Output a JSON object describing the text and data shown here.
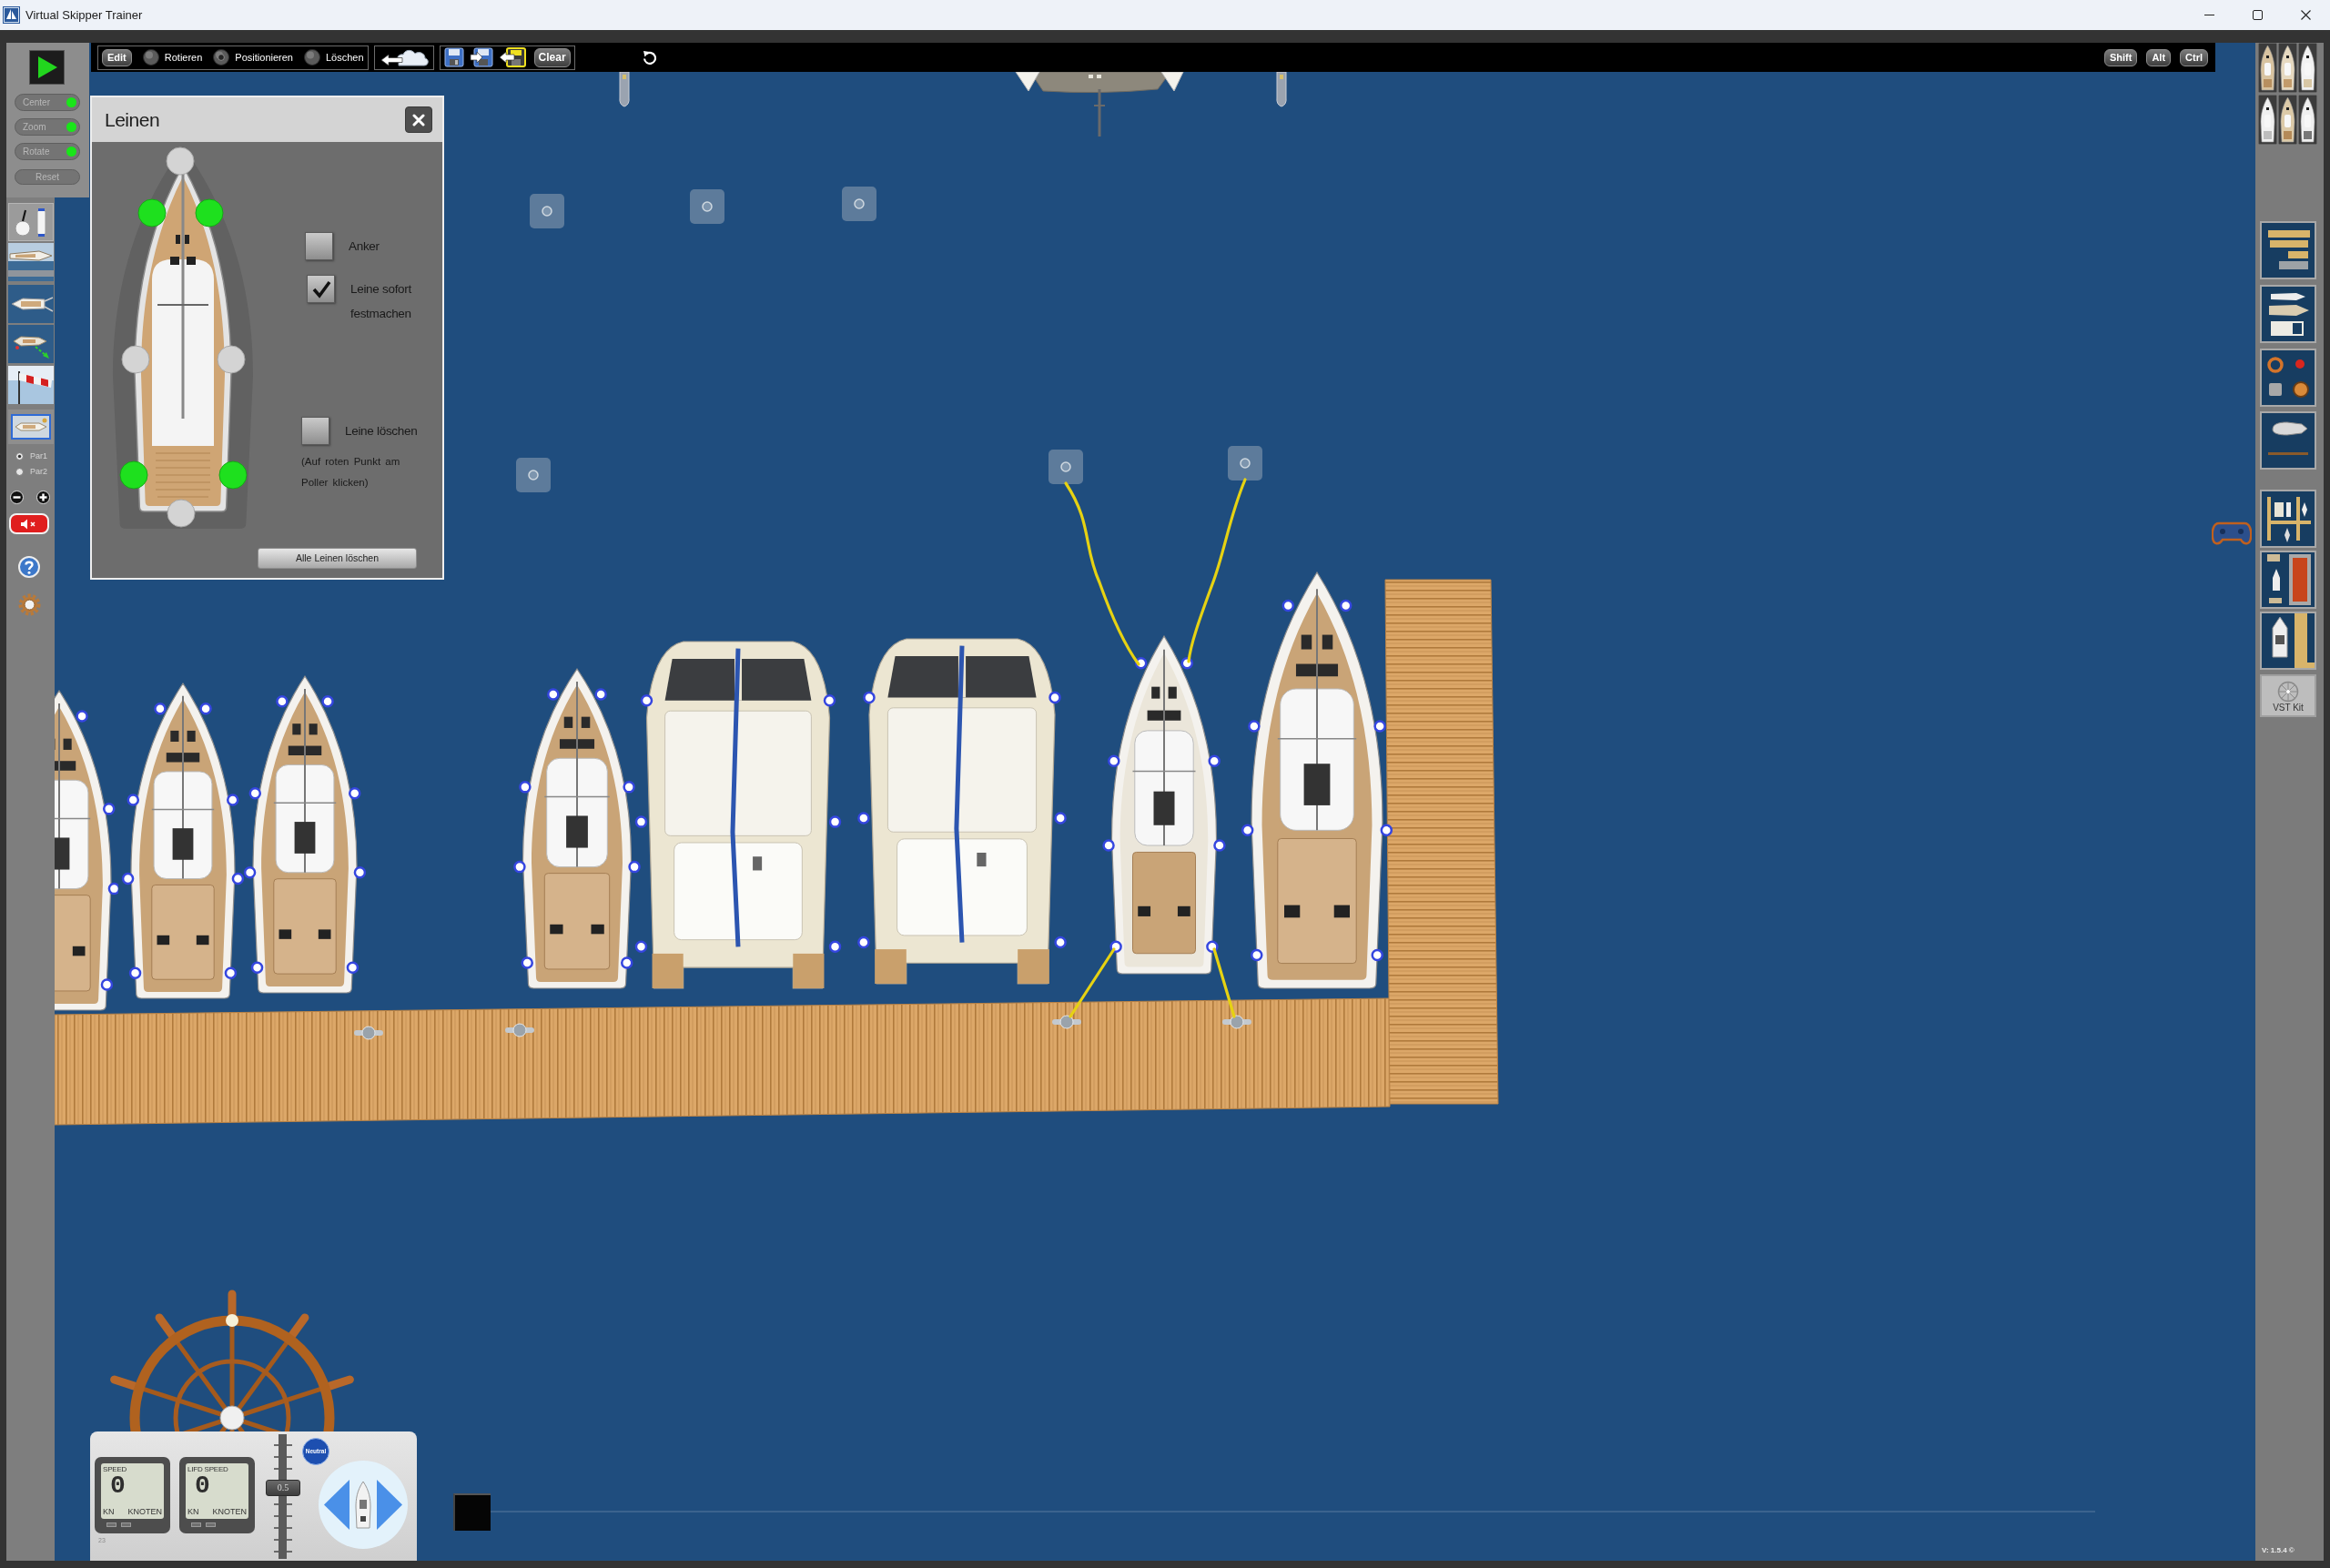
{
  "window": {
    "title": "Virtual Skipper Trainer"
  },
  "toolbar": {
    "edit_button": "Edit",
    "modes": [
      {
        "label": "Rotieren",
        "selected": false
      },
      {
        "label": "Positionieren",
        "selected": true
      },
      {
        "label": "Löschen",
        "selected": false
      }
    ],
    "clear_button": "Clear",
    "modifier_keys": [
      "Shift",
      "Alt",
      "Ctrl"
    ]
  },
  "left_panel": {
    "view_toggles": [
      {
        "label": "Center",
        "on": true
      },
      {
        "label": "Zoom",
        "on": true
      },
      {
        "label": "Rotate",
        "on": true
      }
    ],
    "reset_button": "Reset",
    "parties": [
      {
        "label": "Par1",
        "selected": true
      },
      {
        "label": "Par2",
        "selected": false
      }
    ],
    "sound_muted": true
  },
  "lines_dialog": {
    "title": "Leinen",
    "mooring_points": [
      {
        "active": false
      },
      {
        "active": true
      },
      {
        "active": true
      },
      {
        "active": false
      },
      {
        "active": false
      },
      {
        "active": true
      },
      {
        "active": true
      },
      {
        "active": false
      }
    ],
    "options": [
      {
        "label": "Anker",
        "checked": false
      },
      {
        "label": "Leine sofort festmachen",
        "checked": true
      },
      {
        "label": "Leine löschen",
        "checked": false
      }
    ],
    "hint": "(Auf roten Punkt am Poller klicken)",
    "clear_all_button": "Alle Leinen löschen"
  },
  "instruments": {
    "displays": [
      {
        "label": "SPEED",
        "value": "0",
        "unit": "KN",
        "unit_name": "KNOTEN"
      },
      {
        "label": "LIFD SPEED",
        "value": "0",
        "unit": "KN",
        "unit_name": "KNOTEN"
      }
    ],
    "counter": "23",
    "throttle": {
      "reading": "0.5",
      "level": 0.58
    },
    "gear": "Neutral"
  },
  "timeline": {
    "level": 0
  },
  "right_panel": {
    "kit_button": "VST Kit",
    "version": "V: 1.5.4 ©"
  }
}
